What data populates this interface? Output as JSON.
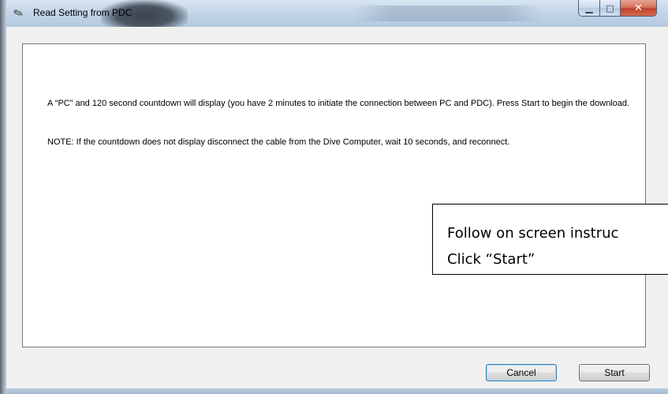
{
  "window": {
    "title": "Read Setting from PDC",
    "app_icon": "tools-icon",
    "controls": {
      "minimize": "▁",
      "maximize": "□",
      "close": "✕"
    }
  },
  "content": {
    "instruction_1": "A “PC” and 120 second countdown will display (you have 2 minutes to initiate the connection between PC and PDC). Press Start to begin the download.",
    "note": "NOTE: If the countdown does not display disconnect the cable from the Dive Computer, wait 10 seconds, and reconnect."
  },
  "callout": {
    "line1": "Follow on screen instruc",
    "line2": "Click “Start”"
  },
  "buttons": {
    "cancel": "Cancel",
    "start": "Start"
  },
  "colors": {
    "title_bar": "#c0d3e7",
    "close_button": "#c2412a",
    "client_background": "#f0f0f0"
  }
}
